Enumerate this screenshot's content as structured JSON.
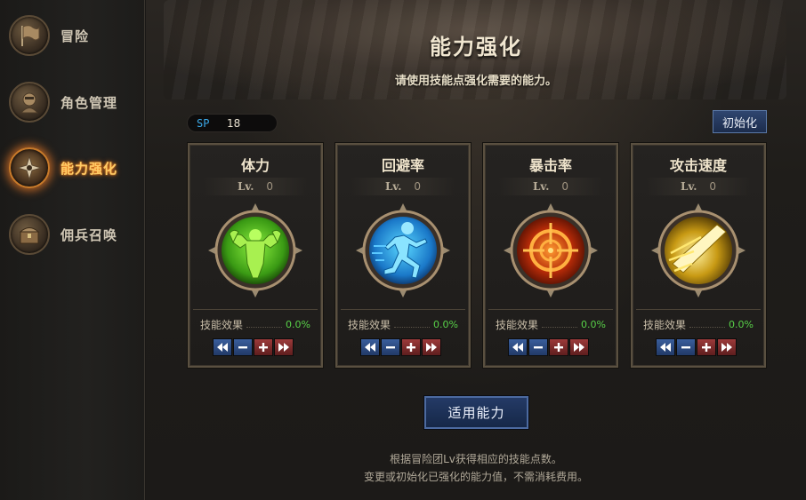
{
  "sidebar": {
    "items": [
      {
        "label": "冒险",
        "icon": "flag-icon",
        "active": false
      },
      {
        "label": "角色管理",
        "icon": "character-icon",
        "active": false
      },
      {
        "label": "能力强化",
        "icon": "shuriken-icon",
        "active": true
      },
      {
        "label": "佣兵召唤",
        "icon": "chest-icon",
        "active": false
      }
    ]
  },
  "header": {
    "title": "能力强化",
    "subtitle": "请使用技能点强化需要的能力。"
  },
  "sp": {
    "label": "SP",
    "value": "18"
  },
  "reset_button": "初始化",
  "cards": [
    {
      "name": "体力",
      "lv_label": "Lv.",
      "lv_value": "0",
      "effect_label": "技能效果",
      "effect_value": "0.0%",
      "icon": "muscle-icon",
      "color": "#6fd02a"
    },
    {
      "name": "回避率",
      "lv_label": "Lv.",
      "lv_value": "0",
      "effect_label": "技能效果",
      "effect_value": "0.0%",
      "icon": "runner-icon",
      "color": "#28a8f0"
    },
    {
      "name": "暴击率",
      "lv_label": "Lv.",
      "lv_value": "0",
      "effect_label": "技能效果",
      "effect_value": "0.0%",
      "icon": "crosshair-icon",
      "color": "#e85a10"
    },
    {
      "name": "攻击速度",
      "lv_label": "Lv.",
      "lv_value": "0",
      "effect_label": "技能效果",
      "effect_value": "0.0%",
      "icon": "sword-slash-icon",
      "color": "#e8c020"
    }
  ],
  "apply_button": "适用能力",
  "footer": {
    "line1": "根据冒险团Lv获得相应的技能点数。",
    "line2": "变更或初始化已强化的能力值，不需消耗费用。"
  },
  "colors": {
    "accent_active": "#ffcc66",
    "effect_value": "#58d048",
    "sp_label": "#3aa8e8"
  }
}
